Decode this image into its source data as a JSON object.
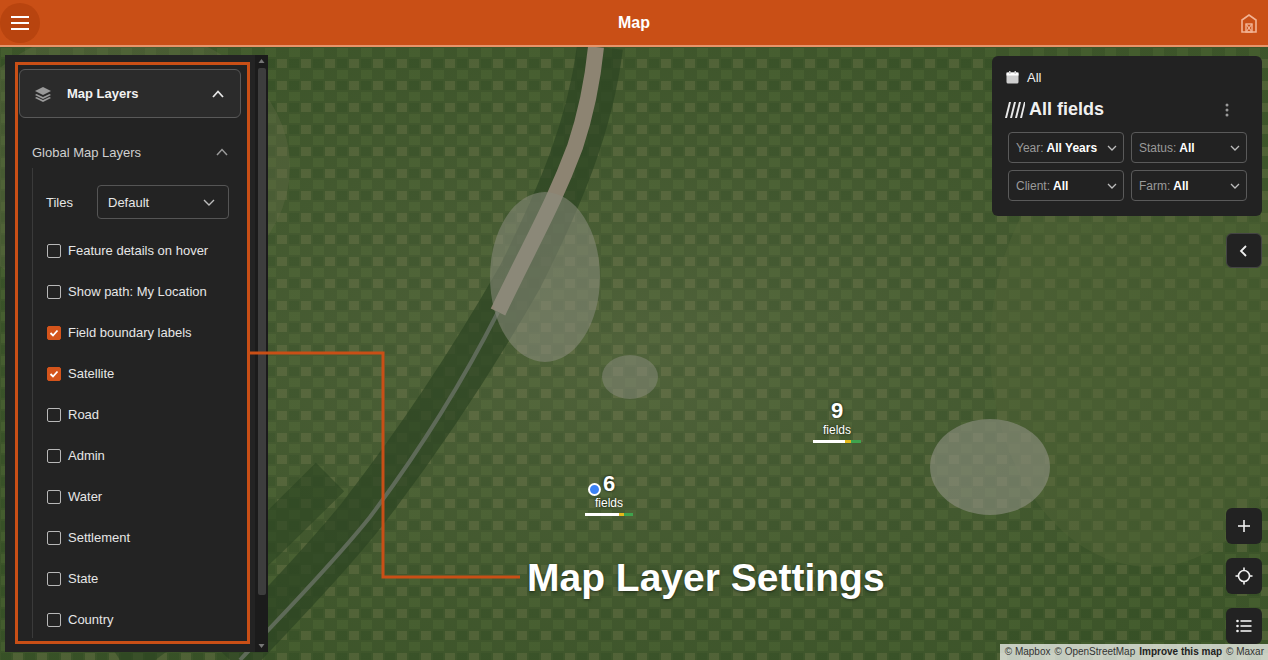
{
  "top_bar": {
    "title": "Map"
  },
  "layers_panel": {
    "title": "Map Layers",
    "expanded": true,
    "section": {
      "title": "Global Map Layers",
      "expanded": true
    },
    "tiles": {
      "label": "Tiles",
      "value": "Default"
    },
    "layers": [
      {
        "label": "Feature details on hover",
        "checked": false
      },
      {
        "label": "Show path: My Location",
        "checked": false
      },
      {
        "label": "Field boundary labels",
        "checked": true
      },
      {
        "label": "Satellite",
        "checked": true
      },
      {
        "label": "Road",
        "checked": false
      },
      {
        "label": "Admin",
        "checked": false
      },
      {
        "label": "Water",
        "checked": false
      },
      {
        "label": "Settlement",
        "checked": false
      },
      {
        "label": "State",
        "checked": false
      },
      {
        "label": "Country",
        "checked": false
      }
    ]
  },
  "annotation": {
    "label": "Map Layer Settings"
  },
  "filter_card": {
    "period": "All",
    "title": "All fields",
    "filters": [
      {
        "label": "Year:",
        "value": "All Years"
      },
      {
        "label": "Status:",
        "value": "All"
      },
      {
        "label": "Client:",
        "value": "All"
      },
      {
        "label": "Farm:",
        "value": "All"
      }
    ]
  },
  "clusters": [
    {
      "count": "9",
      "unit": "fields",
      "segments": [
        {
          "color": "#ffffff",
          "share": 0.66
        },
        {
          "color": "#e3b91c",
          "share": 0.14
        },
        {
          "color": "#3fa34d",
          "share": 0.2
        }
      ]
    },
    {
      "count": "6",
      "unit": "fields",
      "segments": [
        {
          "color": "#ffffff",
          "share": 0.7
        },
        {
          "color": "#e3b91c",
          "share": 0.12
        },
        {
          "color": "#3fa34d",
          "share": 0.18
        }
      ]
    }
  ],
  "attribution": {
    "credits": [
      "© Mapbox",
      "© OpenStreetMap"
    ],
    "link": "Improve this map",
    "tail": "© Maxar"
  }
}
